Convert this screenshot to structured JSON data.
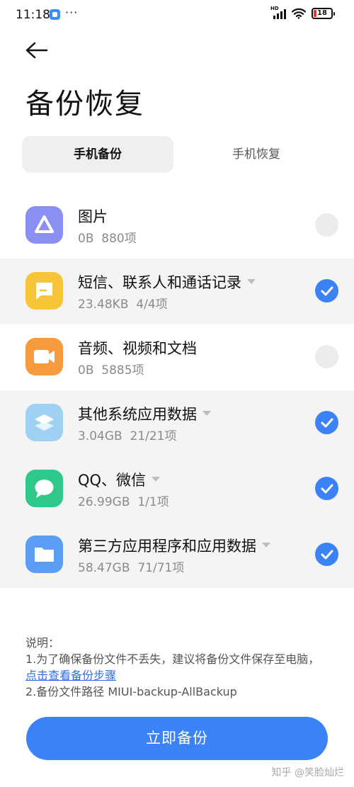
{
  "status_bar": {
    "time": "11:18",
    "dots": "···",
    "hd": "HD",
    "battery": "18"
  },
  "header": {
    "title": "备份恢复"
  },
  "tabs": [
    {
      "label": "手机备份",
      "active": true
    },
    {
      "label": "手机恢复",
      "active": false
    }
  ],
  "items": [
    {
      "name": "图片",
      "size": "0B",
      "count": "880项",
      "selected": false,
      "icon": "image-icon",
      "color": "#8b8ff2"
    },
    {
      "name": "短信、联系人和通话记录",
      "size": "23.48KB",
      "count": "4/4项",
      "selected": true,
      "icon": "message-icon",
      "color": "#f7c53a"
    },
    {
      "name": "音频、视频和文档",
      "size": "0B",
      "count": "5885项",
      "selected": false,
      "icon": "video-icon",
      "color": "#f79a3e"
    },
    {
      "name": "其他系统应用数据",
      "size": "3.04GB",
      "count": "21/21项",
      "selected": true,
      "icon": "layers-icon",
      "color": "#9fd2f2"
    },
    {
      "name": "QQ、微信",
      "size": "26.99GB",
      "count": "1/1项",
      "selected": true,
      "icon": "chat-icon",
      "color": "#2ec98a"
    },
    {
      "name": "第三方应用程序和应用数据",
      "size": "58.47GB",
      "count": "71/71项",
      "selected": true,
      "icon": "folder-icon",
      "color": "#5a9df5"
    }
  ],
  "notes": {
    "heading": "说明：",
    "line1": "1.为了确保备份文件不丢失，建议将备份文件保存至电脑，",
    "link": "点击查看备份步骤",
    "line2": "2.备份文件路径 MIUI-backup-AllBackup"
  },
  "button": {
    "label": "立即备份"
  },
  "watermark": "知乎 @笑脸灿烂",
  "colors": {
    "accent": "#3b82f6",
    "link": "#2f6fe0"
  }
}
